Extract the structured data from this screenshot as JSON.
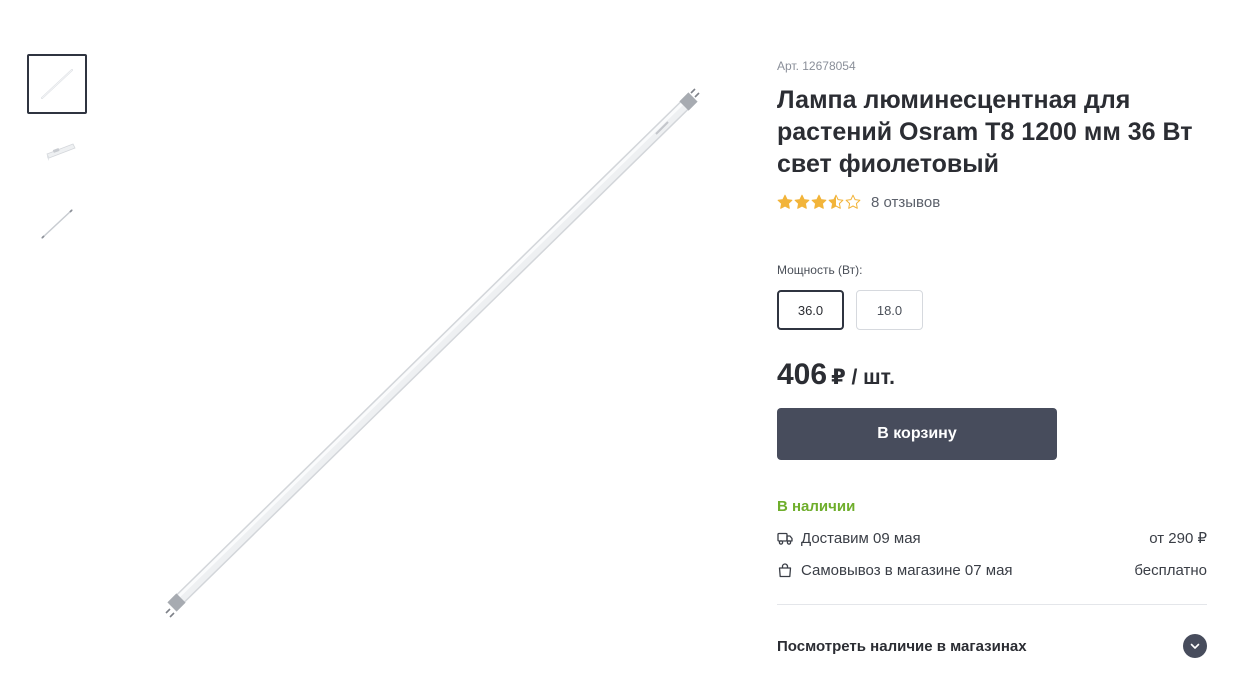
{
  "product": {
    "sku": "Арт. 12678054",
    "title": "Лампа люминесцентная для растений Osram T8 1200 мм 36 Вт свет фиолетовый",
    "rating": 3.5,
    "rating_max": 5,
    "reviews": "8 отзывов"
  },
  "gallery": {
    "thumbnails": [
      "lamp-diagonal",
      "lamp-packaging",
      "lamp-diagonal-small"
    ],
    "active_index": 0
  },
  "options": {
    "label": "Мощность (Вт):",
    "values": [
      "36.0",
      "18.0"
    ],
    "selected": "36.0"
  },
  "price": {
    "value": "406",
    "unit": "₽ / шт."
  },
  "actions": {
    "add_to_cart": "В корзину"
  },
  "availability": {
    "status": "В наличии",
    "delivery_label": "Доставим 09 мая",
    "delivery_price": "от 290 ₽",
    "pickup_label": "Самовывоз в магазине 07 мая",
    "pickup_price": "бесплатно",
    "stores_link": "Посмотреть наличие в магазинах"
  },
  "icons": {
    "star": "star-icon",
    "delivery": "truck-icon",
    "pickup": "bag-icon",
    "expand": "chevron-down-icon"
  },
  "colors": {
    "accent_dark": "#474c5c",
    "in_stock": "#6fae2c",
    "star": "#f2b43a"
  }
}
